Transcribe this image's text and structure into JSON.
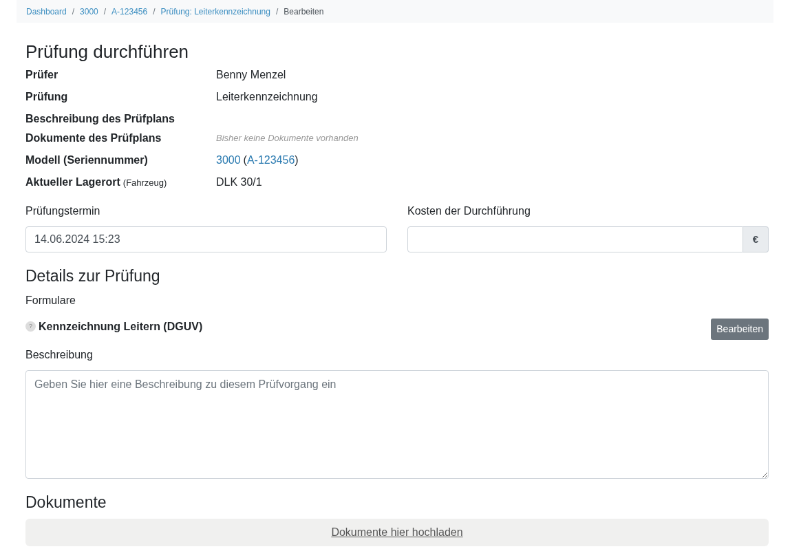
{
  "breadcrumb": [
    {
      "label": "Dashboard",
      "current": false
    },
    {
      "separator": "/",
      "label": "3000",
      "current": false
    },
    {
      "separator": "/",
      "label": "A-123456",
      "current": false
    },
    {
      "separator": "/",
      "label": "Prüfung: Leiterkennzeichnung",
      "current": false
    },
    {
      "separator": "/",
      "label": "Bearbeiten",
      "current": true
    }
  ],
  "title": "Prüfung durchführen",
  "info": [
    {
      "label": "Prüfer",
      "kind": "text",
      "value": "Benny Menzel"
    },
    {
      "label": "Prüfung",
      "kind": "text",
      "value": "Leiterkennzeichnung"
    },
    {
      "label": "Beschreibung des Prüfplans",
      "kind": "empty"
    },
    {
      "label": "Dokumente des Prüfplans",
      "kind": "muted",
      "value": "Bisher keine Dokumente vorhanden"
    },
    {
      "label": "Modell (Seriennummer)",
      "kind": "links",
      "model": "3000",
      "open": "(",
      "serial": "A-123456",
      "close": ")"
    },
    {
      "label": "Aktueller Lagerort",
      "note": "(Fahrzeug)",
      "kind": "text",
      "value": "DLK 30/1"
    }
  ],
  "date_field": {
    "label": "Prüfungstermin",
    "value": "14.06.2024 15:23"
  },
  "cost_field": {
    "label": "Kosten der Durchführung",
    "addon": "€"
  },
  "details_heading": "Details zur Prüfung",
  "forms_label": "Formulare",
  "forms": [
    {
      "name": "Kennzeichnung Leitern (DGUV)",
      "badge": "?",
      "button": "Bearbeiten"
    }
  ],
  "description": {
    "label": "Beschreibung",
    "placeholder": "Geben Sie hier eine Beschreibung zu diesem Prüfvorgang ein"
  },
  "documents": {
    "heading": "Dokumente",
    "upload": "Dokumente hier hochladen"
  }
}
